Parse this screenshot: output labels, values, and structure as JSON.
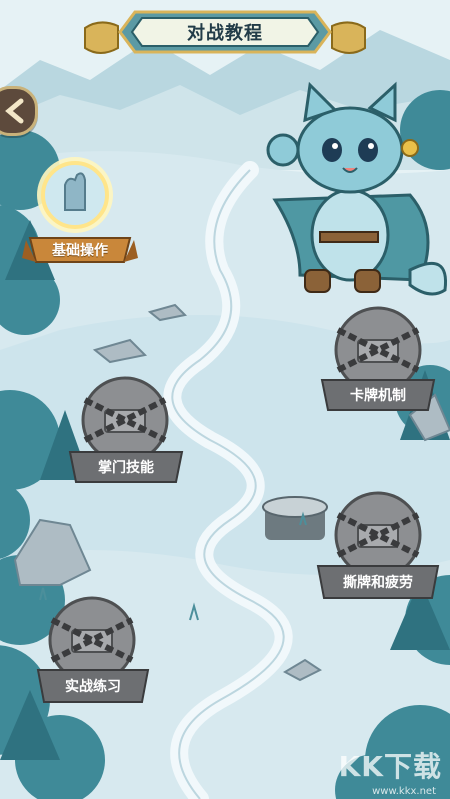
{
  "header": {
    "title": "对战教程"
  },
  "nodes": [
    {
      "id": "basic",
      "label": "基础操作",
      "locked": false
    },
    {
      "id": "cards",
      "label": "卡牌机制",
      "locked": true
    },
    {
      "id": "sect",
      "label": "掌门技能",
      "locked": true
    },
    {
      "id": "tear",
      "label": "撕牌和疲劳",
      "locked": true
    },
    {
      "id": "practice",
      "label": "实战练习",
      "locked": true
    }
  ],
  "watermark": {
    "main": "KK下载",
    "sub": "www.kkx.net"
  },
  "colors": {
    "lake": "#cfe6ee",
    "path": "#eef7fa",
    "tree": "#3e8896",
    "banner_gold": "#d9b45a",
    "lock_gray": "#8a8c8f",
    "label_gray": "#6d6f72"
  }
}
